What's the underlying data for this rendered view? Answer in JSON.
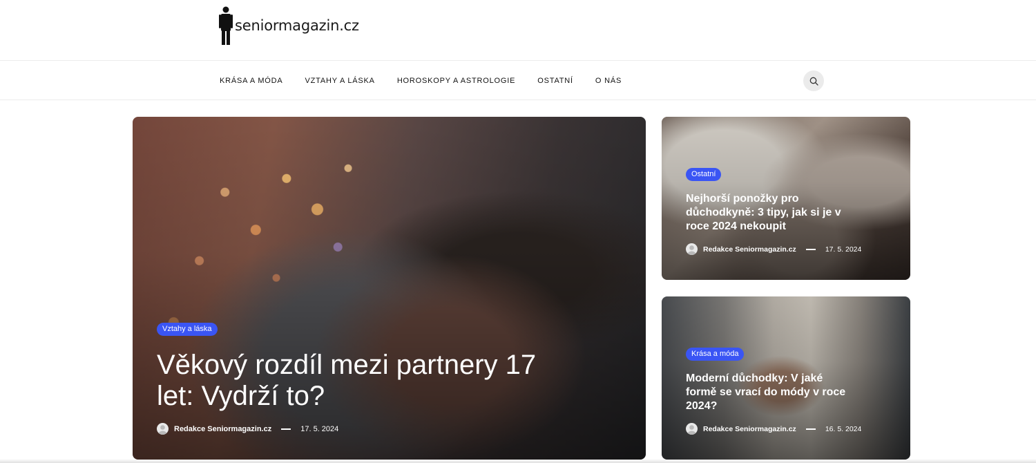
{
  "site": {
    "logo_text": "seniormagazin.cz",
    "logo_icon": "senior-figure-icon"
  },
  "nav": {
    "items": [
      {
        "label": "KRÁSA A MÓDA"
      },
      {
        "label": "VZTAHY A LÁSKA"
      },
      {
        "label": "HOROSKOPY A ASTROLOGIE"
      },
      {
        "label": "OSTATNÍ"
      },
      {
        "label": "O NÁS"
      }
    ],
    "search_icon": "search-icon"
  },
  "colors": {
    "badge": "#3a55f4",
    "nav_text": "#111111",
    "search_bg": "#ebebeb"
  },
  "articles": {
    "main": {
      "category": "Vztahy a láska",
      "title": "Věkový rozdíl mezi partnery 17 let: Vydrží to?",
      "author": "Redakce Seniormagazin.cz",
      "date": "17. 5. 2024"
    },
    "side": [
      {
        "category": "Ostatní",
        "title": "Nejhorší ponožky pro důchodkyně: 3 tipy, jak si je v roce 2024 nekoupit",
        "author": "Redakce Seniormagazin.cz",
        "date": "17. 5. 2024"
      },
      {
        "category": "Krása a móda",
        "title": "Moderní důchodky: V jaké formě se vrací do módy v roce 2024?",
        "author": "Redakce Seniormagazin.cz",
        "date": "16. 5. 2024"
      }
    ]
  }
}
